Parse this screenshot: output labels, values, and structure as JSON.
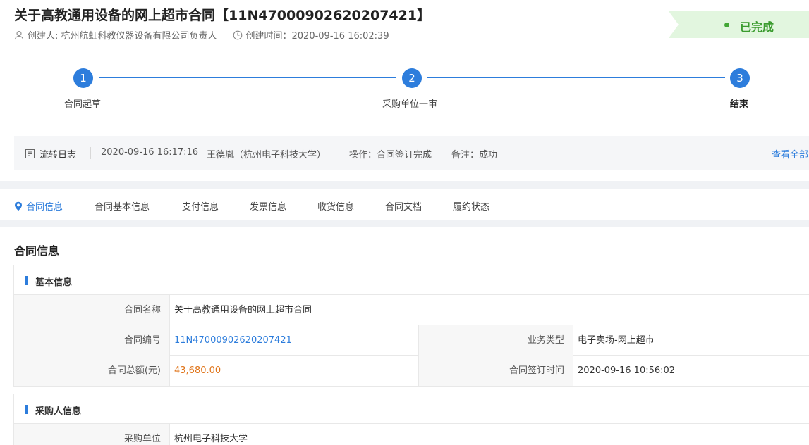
{
  "header": {
    "title": "关于高教通用设备的网上超市合同【11N47000902620207421】",
    "creator": "创建人: 杭州航虹科教仪器设备有限公司负责人",
    "created_time": "创建时间：2020-09-16 16:02:39",
    "status": "已完成",
    "status_color": "#3a9b2e"
  },
  "steps": [
    {
      "num": "1",
      "label": "合同起草"
    },
    {
      "num": "2",
      "label": "采购单位一审"
    },
    {
      "num": "3",
      "label": "结束"
    }
  ],
  "log": {
    "label": "流转日志",
    "time": "2020-09-16 16:17:16",
    "user": "王德胤（杭州电子科技大学）",
    "operation": "操作：合同签订完成",
    "remark": "备注：成功",
    "view_all": "查看全部"
  },
  "tabs": [
    "合同信息",
    "合同基本信息",
    "支付信息",
    "发票信息",
    "收货信息",
    "合同文档",
    "履约状态"
  ],
  "content": {
    "section_title": "合同信息",
    "basic": {
      "title": "基本信息",
      "name_label": "合同名称",
      "name_value": "关于高教通用设备的网上超市合同",
      "no_label": "合同编号",
      "no_value": "11N47000902620207421",
      "type_label": "业务类型",
      "type_value": "电子卖场-网上超市",
      "amount_label": "合同总额(元)",
      "amount_value": "43,680.00",
      "sign_label": "合同签订时间",
      "sign_value": "2020-09-16 10:56:02"
    },
    "buyer": {
      "title": "采购人信息",
      "unit_label": "采购单位",
      "unit_value": "杭州电子科技大学"
    }
  },
  "colors": {
    "accent": "#2d7ddc",
    "amount": "#e0751b",
    "status_bg": "#e2f6df"
  }
}
